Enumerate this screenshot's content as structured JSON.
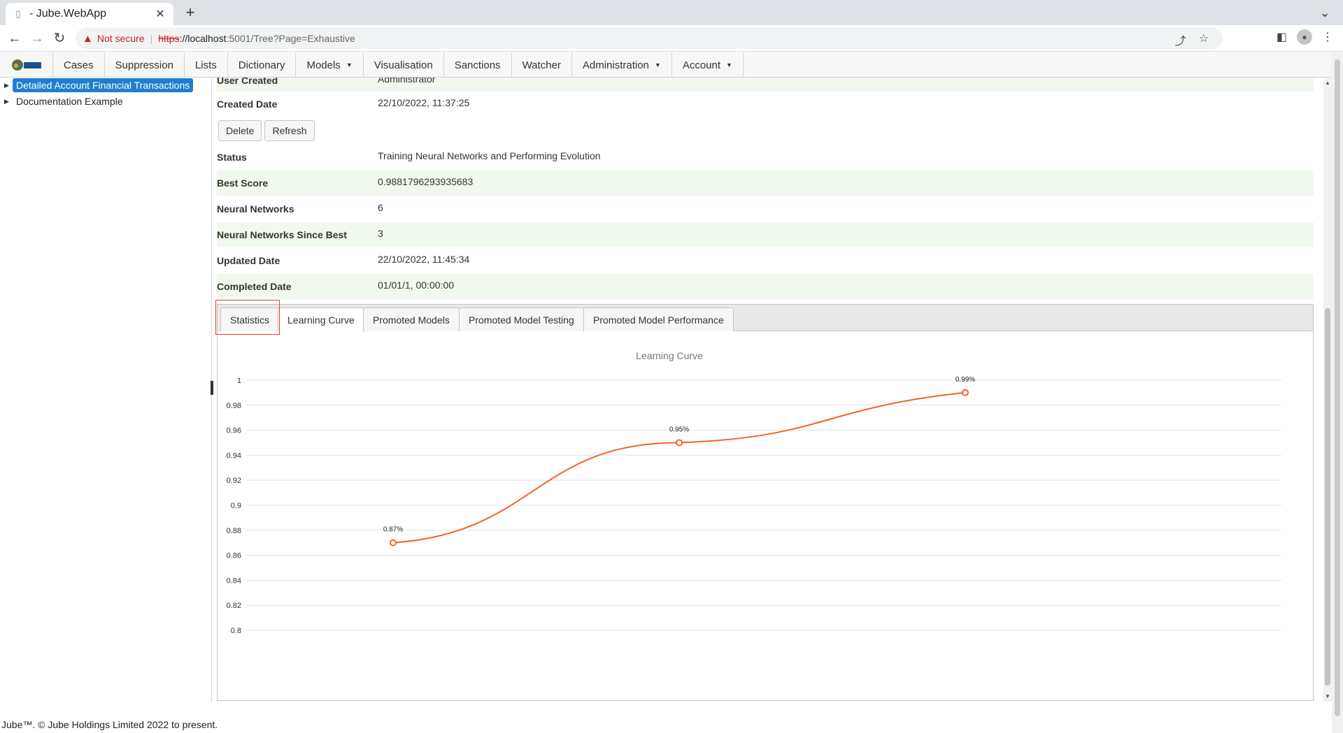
{
  "browser": {
    "tab_title": "- Jube.WebApp",
    "not_secure": "Not secure",
    "url_scheme": "https",
    "url_host": "://localhost",
    "url_path": ":5001/Tree?Page=Exhaustive"
  },
  "nav": {
    "items": [
      {
        "label": "Cases"
      },
      {
        "label": "Suppression"
      },
      {
        "label": "Lists"
      },
      {
        "label": "Dictionary"
      },
      {
        "label": "Models",
        "dropdown": true
      },
      {
        "label": "Visualisation"
      },
      {
        "label": "Sanctions"
      },
      {
        "label": "Watcher"
      },
      {
        "label": "Administration",
        "dropdown": true
      },
      {
        "label": "Account",
        "dropdown": true
      }
    ]
  },
  "tree": {
    "items": [
      {
        "label": "Detailed Account Financial Transactions",
        "selected": true
      },
      {
        "label": "Documentation Example",
        "selected": false
      }
    ]
  },
  "details": {
    "top_rows": [
      {
        "label": "User Created",
        "value": "Administrator"
      },
      {
        "label": "Created Date",
        "value": "22/10/2022, 11:37:25"
      }
    ],
    "buttons": {
      "delete": "Delete",
      "refresh": "Refresh"
    },
    "rows": [
      {
        "label": "Status",
        "value": "Training Neural Networks and Performing Evolution"
      },
      {
        "label": "Best Score",
        "value": "0.9881796293935683"
      },
      {
        "label": "Neural Networks",
        "value": "6"
      },
      {
        "label": "Neural Networks Since Best",
        "value": "3"
      },
      {
        "label": "Updated Date",
        "value": "22/10/2022, 11:45:34"
      },
      {
        "label": "Completed Date",
        "value": "01/01/1, 00:00:00"
      }
    ]
  },
  "tabs": [
    {
      "label": "Statistics",
      "active": false
    },
    {
      "label": "Learning Curve",
      "active": true
    },
    {
      "label": "Promoted Models",
      "active": false
    },
    {
      "label": "Promoted Model Testing",
      "active": false
    },
    {
      "label": "Promoted Model Performance",
      "active": false
    }
  ],
  "colors": {
    "series": "#f26522",
    "selected": "#1f7ed0",
    "highlight": "#e53935"
  },
  "chart_data": {
    "type": "line",
    "title": "Learning Curve",
    "x": [
      1,
      2,
      3
    ],
    "values": [
      0.87,
      0.95,
      0.99
    ],
    "data_labels": [
      "0.87%",
      "0.95%",
      "0.99%"
    ],
    "ylim": [
      0.8,
      1
    ],
    "yticks": [
      "1",
      "0.98",
      "0.96",
      "0.94",
      "0.92",
      "0.9",
      "0.88",
      "0.86",
      "0.84",
      "0.82",
      "0.8"
    ],
    "grid": true,
    "legend": "none"
  },
  "footer": {
    "text": "Jube™. © Jube Holdings Limited 2022 to present."
  }
}
